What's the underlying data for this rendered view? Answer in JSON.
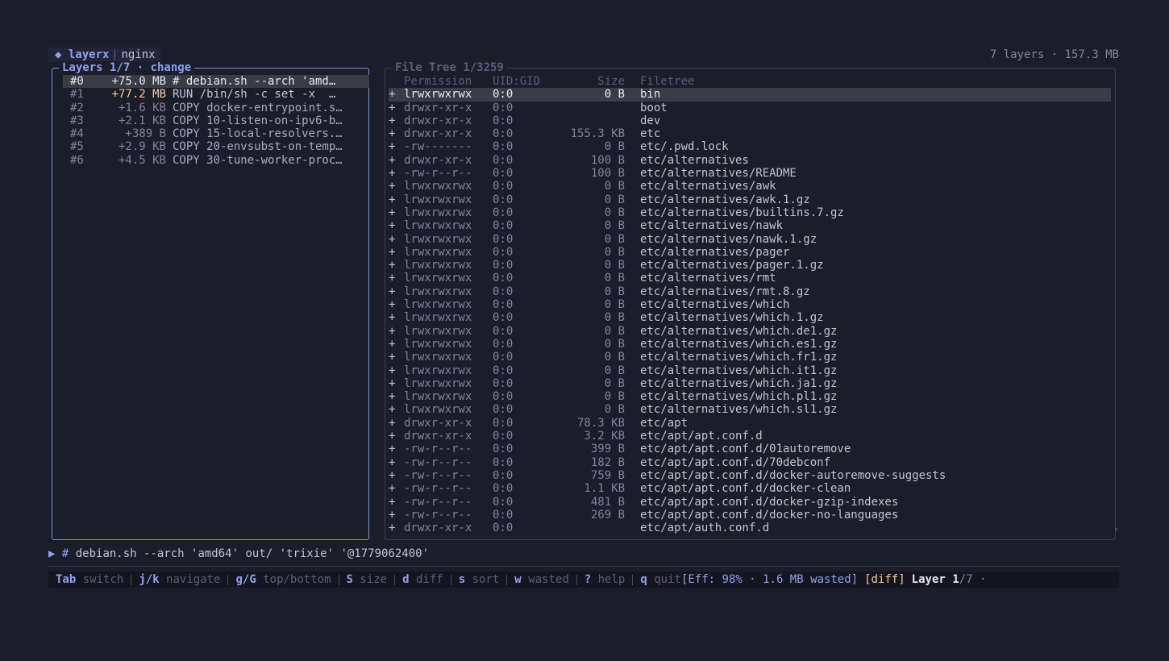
{
  "header": {
    "app_name": "layerx",
    "image_name": "nginx",
    "summary": "7 layers · 157.3 MB"
  },
  "layers_panel": {
    "title": "Layers 1/7 · change",
    "layers": [
      {
        "id": "#0",
        "size": "+75.0 MB",
        "command": "# debian.sh --arch 'amd…"
      },
      {
        "id": "#1",
        "size": "+77.2 MB",
        "command": "RUN /bin/sh -c set -x  …"
      },
      {
        "id": "#2",
        "size": "+1.6 KB",
        "command": "COPY docker-entrypoint.s…"
      },
      {
        "id": "#3",
        "size": "+2.1 KB",
        "command": "COPY 10-listen-on-ipv6-b…"
      },
      {
        "id": "#4",
        "size": "+389 B",
        "command": "COPY 15-local-resolvers.…"
      },
      {
        "id": "#5",
        "size": "+2.9 KB",
        "command": "COPY 20-envsubst-on-temp…"
      },
      {
        "id": "#6",
        "size": "+4.5 KB",
        "command": "COPY 30-tune-worker-proc…"
      }
    ]
  },
  "tree_panel": {
    "title": "File Tree 1/3259",
    "columns": {
      "permission": "Permission",
      "uid_gid": "UID:GID",
      "size": "Size",
      "filetree": "Filetree"
    },
    "rows": [
      {
        "mark": "+",
        "perm": "lrwxrwxrwx",
        "uid": "0:0",
        "size": "0 B",
        "name": "bin"
      },
      {
        "mark": "+",
        "perm": "drwxr-xr-x",
        "uid": "0:0",
        "size": "",
        "name": "boot"
      },
      {
        "mark": "+",
        "perm": "drwxr-xr-x",
        "uid": "0:0",
        "size": "",
        "name": "dev"
      },
      {
        "mark": "+",
        "perm": "drwxr-xr-x",
        "uid": "0:0",
        "size": "155.3 KB",
        "name": "etc"
      },
      {
        "mark": "+",
        "perm": "-rw-------",
        "uid": "0:0",
        "size": "0 B",
        "name": "etc/.pwd.lock"
      },
      {
        "mark": "+",
        "perm": "drwxr-xr-x",
        "uid": "0:0",
        "size": "100 B",
        "name": "etc/alternatives"
      },
      {
        "mark": "+",
        "perm": "-rw-r--r--",
        "uid": "0:0",
        "size": "100 B",
        "name": "etc/alternatives/README"
      },
      {
        "mark": "+",
        "perm": "lrwxrwxrwx",
        "uid": "0:0",
        "size": "0 B",
        "name": "etc/alternatives/awk"
      },
      {
        "mark": "+",
        "perm": "lrwxrwxrwx",
        "uid": "0:0",
        "size": "0 B",
        "name": "etc/alternatives/awk.1.gz"
      },
      {
        "mark": "+",
        "perm": "lrwxrwxrwx",
        "uid": "0:0",
        "size": "0 B",
        "name": "etc/alternatives/builtins.7.gz"
      },
      {
        "mark": "+",
        "perm": "lrwxrwxrwx",
        "uid": "0:0",
        "size": "0 B",
        "name": "etc/alternatives/nawk"
      },
      {
        "mark": "+",
        "perm": "lrwxrwxrwx",
        "uid": "0:0",
        "size": "0 B",
        "name": "etc/alternatives/nawk.1.gz"
      },
      {
        "mark": "+",
        "perm": "lrwxrwxrwx",
        "uid": "0:0",
        "size": "0 B",
        "name": "etc/alternatives/pager"
      },
      {
        "mark": "+",
        "perm": "lrwxrwxrwx",
        "uid": "0:0",
        "size": "0 B",
        "name": "etc/alternatives/pager.1.gz"
      },
      {
        "mark": "+",
        "perm": "lrwxrwxrwx",
        "uid": "0:0",
        "size": "0 B",
        "name": "etc/alternatives/rmt"
      },
      {
        "mark": "+",
        "perm": "lrwxrwxrwx",
        "uid": "0:0",
        "size": "0 B",
        "name": "etc/alternatives/rmt.8.gz"
      },
      {
        "mark": "+",
        "perm": "lrwxrwxrwx",
        "uid": "0:0",
        "size": "0 B",
        "name": "etc/alternatives/which"
      },
      {
        "mark": "+",
        "perm": "lrwxrwxrwx",
        "uid": "0:0",
        "size": "0 B",
        "name": "etc/alternatives/which.1.gz"
      },
      {
        "mark": "+",
        "perm": "lrwxrwxrwx",
        "uid": "0:0",
        "size": "0 B",
        "name": "etc/alternatives/which.de1.gz"
      },
      {
        "mark": "+",
        "perm": "lrwxrwxrwx",
        "uid": "0:0",
        "size": "0 B",
        "name": "etc/alternatives/which.es1.gz"
      },
      {
        "mark": "+",
        "perm": "lrwxrwxrwx",
        "uid": "0:0",
        "size": "0 B",
        "name": "etc/alternatives/which.fr1.gz"
      },
      {
        "mark": "+",
        "perm": "lrwxrwxrwx",
        "uid": "0:0",
        "size": "0 B",
        "name": "etc/alternatives/which.it1.gz"
      },
      {
        "mark": "+",
        "perm": "lrwxrwxrwx",
        "uid": "0:0",
        "size": "0 B",
        "name": "etc/alternatives/which.ja1.gz"
      },
      {
        "mark": "+",
        "perm": "lrwxrwxrwx",
        "uid": "0:0",
        "size": "0 B",
        "name": "etc/alternatives/which.pl1.gz"
      },
      {
        "mark": "+",
        "perm": "lrwxrwxrwx",
        "uid": "0:0",
        "size": "0 B",
        "name": "etc/alternatives/which.sl1.gz"
      },
      {
        "mark": "+",
        "perm": "drwxr-xr-x",
        "uid": "0:0",
        "size": "78.3 KB",
        "name": "etc/apt"
      },
      {
        "mark": "+",
        "perm": "drwxr-xr-x",
        "uid": "0:0",
        "size": "3.2 KB",
        "name": "etc/apt/apt.conf.d"
      },
      {
        "mark": "+",
        "perm": "-rw-r--r--",
        "uid": "0:0",
        "size": "399 B",
        "name": "etc/apt/apt.conf.d/01autoremove"
      },
      {
        "mark": "+",
        "perm": "-rw-r--r--",
        "uid": "0:0",
        "size": "182 B",
        "name": "etc/apt/apt.conf.d/70debconf"
      },
      {
        "mark": "+",
        "perm": "-rw-r--r--",
        "uid": "0:0",
        "size": "759 B",
        "name": "etc/apt/apt.conf.d/docker-autoremove-suggests"
      },
      {
        "mark": "+",
        "perm": "-rw-r--r--",
        "uid": "0:0",
        "size": "1.1 KB",
        "name": "etc/apt/apt.conf.d/docker-clean"
      },
      {
        "mark": "+",
        "perm": "-rw-r--r--",
        "uid": "0:0",
        "size": "481 B",
        "name": "etc/apt/apt.conf.d/docker-gzip-indexes"
      },
      {
        "mark": "+",
        "perm": "-rw-r--r--",
        "uid": "0:0",
        "size": "269 B",
        "name": "etc/apt/apt.conf.d/docker-no-languages"
      },
      {
        "mark": "+",
        "perm": "drwxr-xr-x",
        "uid": "0:0",
        "size": "",
        "name": "etc/apt/auth.conf.d"
      }
    ]
  },
  "command_line": {
    "prefix": "▶ #",
    "text": " debian.sh --arch 'amd64' out/ 'trixie' '@1779062400'"
  },
  "statusbar": {
    "items": [
      {
        "key": "Tab",
        "desc": "switch"
      },
      {
        "key": "j/k",
        "desc": "navigate"
      },
      {
        "key": "g/G",
        "desc": "top/bottom"
      },
      {
        "key": "S",
        "desc": "size"
      },
      {
        "key": "d",
        "desc": "diff"
      },
      {
        "key": "s",
        "desc": "sort"
      },
      {
        "key": "w",
        "desc": "wasted"
      },
      {
        "key": "?",
        "desc": "help"
      },
      {
        "key": "q",
        "desc": "quit"
      }
    ],
    "efficiency": "[Eff: 98% · 1.6 MB wasted]",
    "mode": "[diff]",
    "layer_label": "Layer 1",
    "layer_total": "/7 ·"
  },
  "icons": {
    "brand": "◆",
    "selected_arrow": "▸",
    "scroll_down": "▾"
  },
  "colors": {
    "accent": "#8ea2f0",
    "highlight": "#f5c89a",
    "background": "#1c1d2b"
  }
}
